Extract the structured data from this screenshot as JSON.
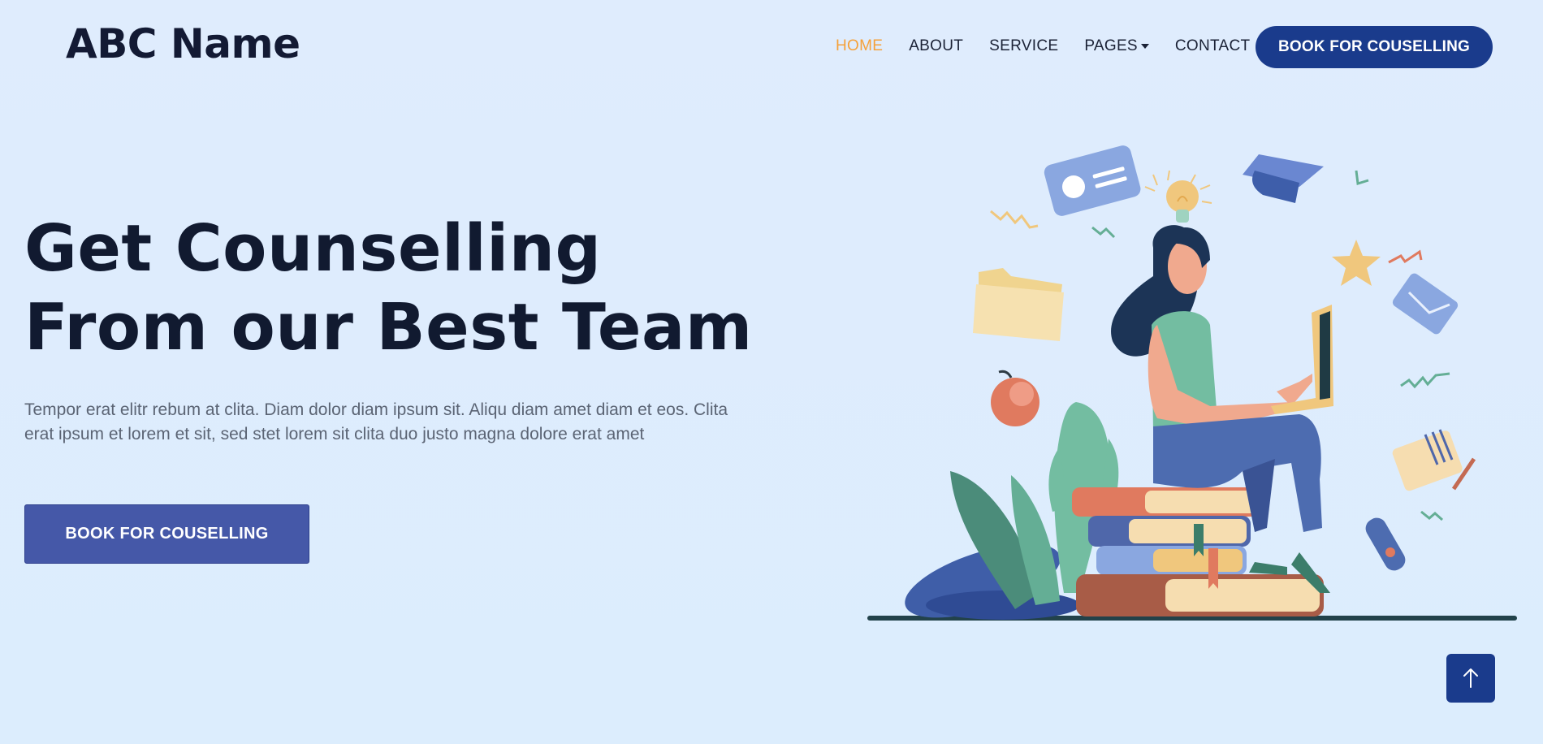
{
  "brand": {
    "name": "ABC Name"
  },
  "nav": {
    "items": [
      {
        "label": "HOME",
        "active": true
      },
      {
        "label": "ABOUT"
      },
      {
        "label": "SERVICE"
      },
      {
        "label": "PAGES",
        "dropdown": true
      },
      {
        "label": "CONTACT"
      }
    ],
    "cta_label": "BOOK FOR COUSELLING"
  },
  "hero": {
    "title_line1": "Get Counselling",
    "title_line2": "From our Best Team",
    "description": "Tempor erat elitr rebum at clita. Diam dolor diam ipsum sit. Aliqu diam amet diam et eos. Clita erat ipsum et lorem et sit, sed stet lorem sit clita duo justo magna dolore erat amet",
    "button_label": "BOOK FOR COUSELLING"
  },
  "colors": {
    "accent": "#f5a13a",
    "primary": "#1a3b8c",
    "button": "#4558a8",
    "background": "#dfecfd"
  },
  "icons": {
    "dropdown": "caret-down-icon",
    "back_to_top": "arrow-up-icon"
  }
}
